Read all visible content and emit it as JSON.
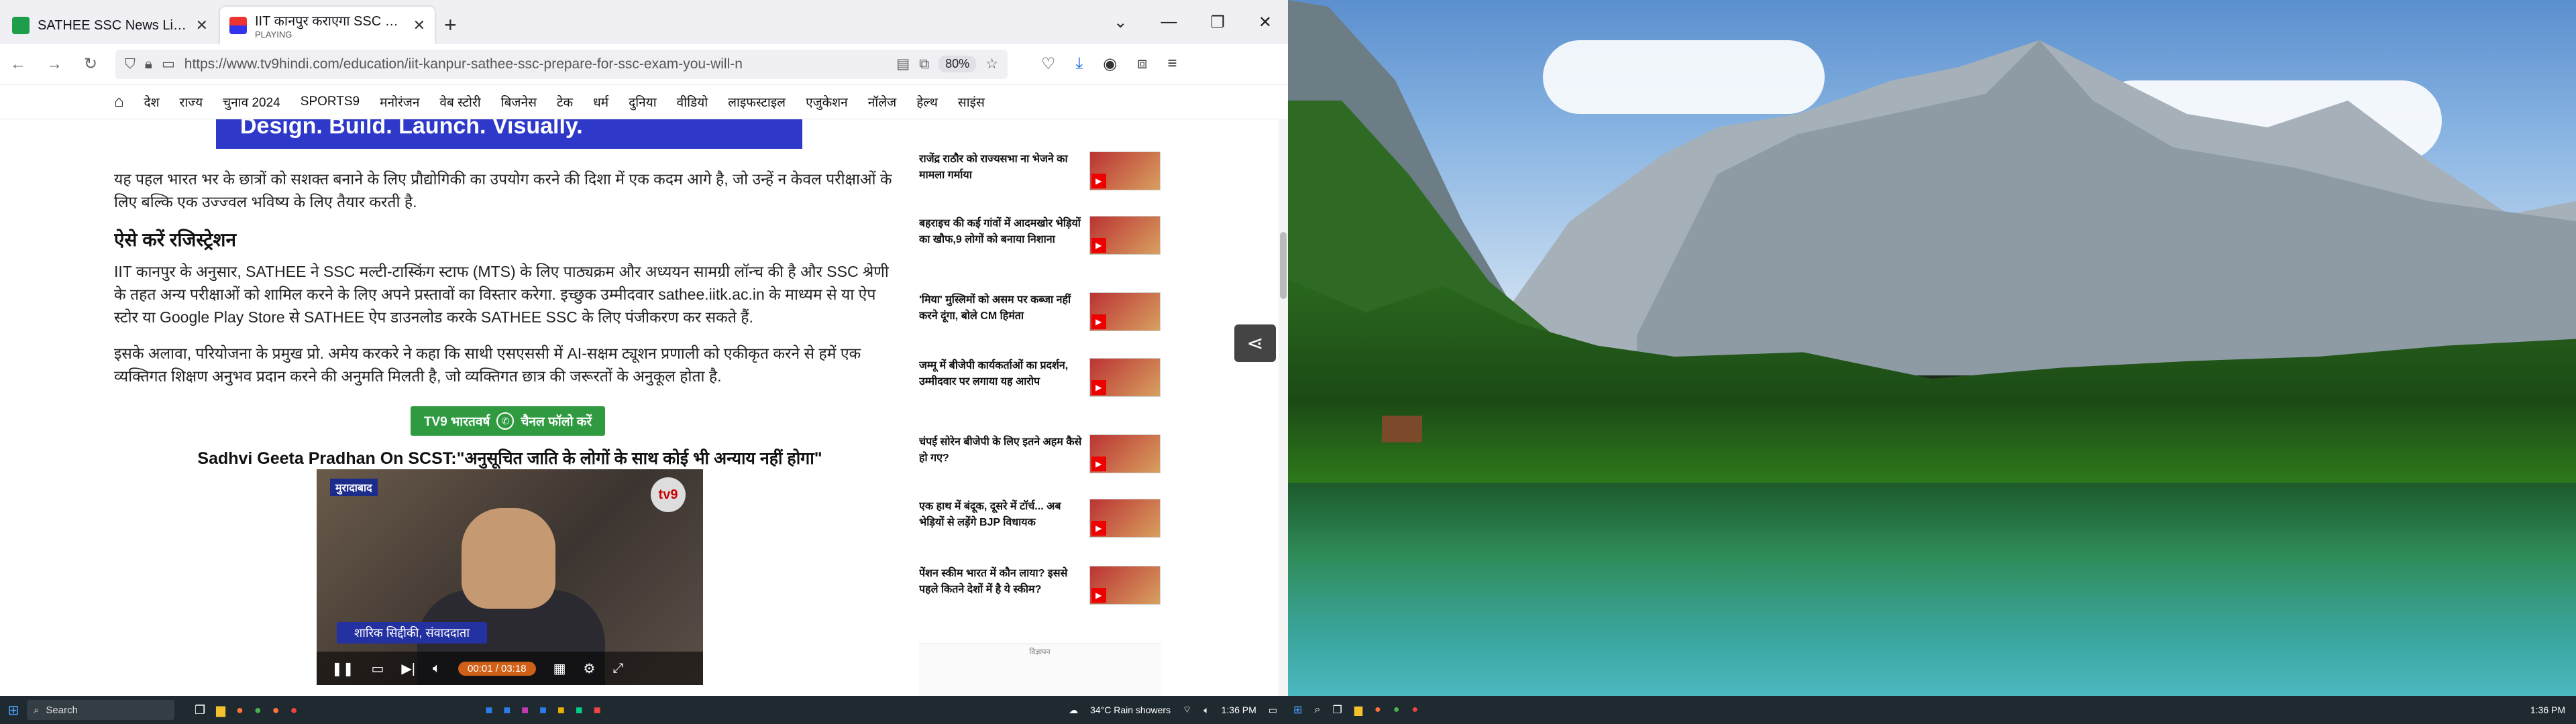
{
  "browser": {
    "tabs": [
      {
        "label": "SATHEE SSC News Links - Goog",
        "sub": "",
        "active": false
      },
      {
        "label": "IIT कानपुर कराएगा SSC की तैयारी",
        "sub": "PLAYING",
        "active": true
      }
    ],
    "url": "https://www.tv9hindi.com/education/iit-kanpur-sathee-ssc-prepare-for-ssc-exam-you-will-n",
    "zoom": "80%"
  },
  "sitenav": [
    "देश",
    "राज्य",
    "चुनाव 2024",
    "SPORTS9",
    "मनोरंजन",
    "वेब स्टोरी",
    "बिजनेस",
    "टेक",
    "धर्म",
    "दुनिया",
    "वीडियो",
    "लाइफस्टाइल",
    "एजुकेशन",
    "नॉलेज",
    "हेल्थ",
    "साइंस"
  ],
  "article": {
    "banner": "Design. Build. Launch. Visually.",
    "para1": "यह पहल भारत भर के छात्रों को सशक्त बनाने के लिए प्रौद्योगिकी का उपयोग करने की दिशा में एक कदम आगे है, जो उन्हें न केवल परीक्षाओं के लिए बल्कि एक उज्ज्वल भविष्य के लिए तैयार करती है.",
    "heading": "ऐसे करें रजिस्ट्रेशन",
    "para2": "IIT कानपुर के अनुसार, SATHEE ने SSC मल्टी-टास्किंग स्टाफ (MTS) के लिए पाठ्यक्रम और अध्ययन सामग्री लॉन्च की है और SSC श्रेणी के तहत अन्य परीक्षाओं को शामिल करने के लिए अपने प्रस्तावों का विस्तार करेगा. इच्छुक उम्मीदवार sathee.iitk.ac.in के माध्यम से या ऐप स्टोर या Google Play Store से SATHEE ऐप डाउनलोड करके SATHEE SSC के लिए पंजीकरण कर सकते हैं.",
    "para3": "इसके अलावा, परियोजना के प्रमुख प्रो. अमेय करकरे ने कहा कि साथी एसएससी में AI-सक्षम ट्यूशन प्रणाली को एकीकृत करने से हमें एक व्यक्तिगत शिक्षण अनुभव प्रदान करने की अनुमति मिलती है, जो व्यक्तिगत छात्र की जरूरतों के अनुकूल होता है.",
    "follow_prefix": "TV9 भारतवर्ष",
    "follow_suffix": "चैनल फॉलो करें",
    "video_title": "Sadhvi Geeta Pradhan On SCST:\"अनुसूचित जाति के लोगों के साथ कोई भी अन्याय नहीं होगा\"",
    "video_location": "मुरादाबाद",
    "video_caption": "शारिक सिद्दीकी, संवाददाता",
    "video_time": "00:01 / 03:18"
  },
  "sidebar": {
    "news": [
      "राजेंद्र राठौर को राज्यसभा ना भेजने का मामला गर्माया",
      "बहराइच की कई गांवों में आदमखोर भेड़ियों का खौफ,9 लोगों को बनाया निशाना",
      "'मिया' मुस्लिमों को असम पर कब्जा नहीं करने दूंगा, बोले CM हिमंता",
      "जम्मू में बीजेपी कार्यकर्ताओं का प्रदर्शन, उम्मीदवार पर लगाया यह आरोप",
      "चंपई सोरेन बीजेपी के लिए इतने अहम कैसे हो गए?",
      "एक हाथ में बंदूक, दूसरे में टॉर्च... अब भेड़ियों से लड़ेंगे BJP विधायक",
      "पेंशन स्कीम भारत में कौन लाया? इससे पहले कितने देशों में है ये स्कीम?"
    ],
    "ad_label": "विज्ञापन"
  },
  "taskbar": {
    "search": "Search",
    "weather": "34°C  Rain showers",
    "time": "1:36 PM",
    "time2": "1:36 PM"
  }
}
